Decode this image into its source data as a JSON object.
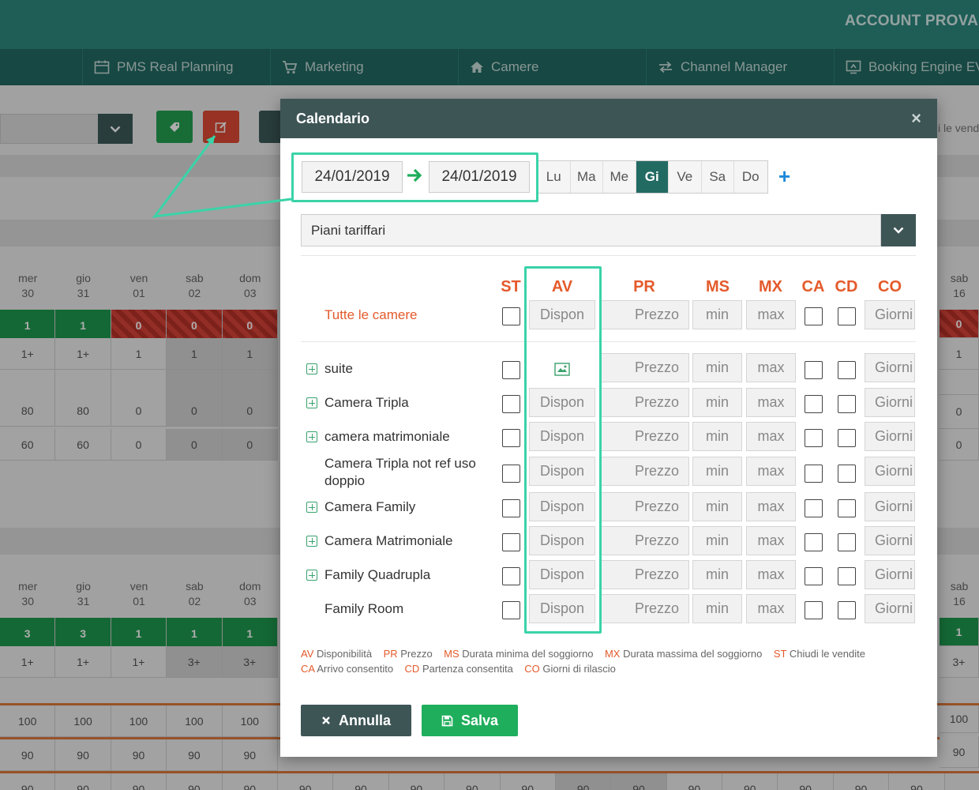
{
  "header": {
    "account": "ACCOUNT PROVA SU"
  },
  "nav": [
    {
      "label": "PMS Real Planning",
      "icon": "calendar-icon"
    },
    {
      "label": "Marketing",
      "icon": "cart-icon"
    },
    {
      "label": "Camere",
      "icon": "home-icon"
    },
    {
      "label": "Channel Manager",
      "icon": "arrows-icon"
    },
    {
      "label": "Booking Engine EVO",
      "icon": "screen-icon"
    }
  ],
  "background": {
    "side_text": "i le vendi",
    "days": [
      {
        "d": "mer",
        "n": "30"
      },
      {
        "d": "gio",
        "n": "31"
      },
      {
        "d": "ven",
        "n": "01"
      },
      {
        "d": "sab",
        "n": "02"
      },
      {
        "d": "dom",
        "n": "03"
      }
    ],
    "right_day": {
      "d": "sab",
      "n": "16"
    },
    "block1": {
      "avail": [
        "1",
        "1",
        "0",
        "0",
        "0"
      ],
      "right_avail": "0",
      "min": [
        "1+",
        "1+",
        "1",
        "1",
        "1"
      ],
      "right_min": "1",
      "row3": [
        "80",
        "80",
        "0",
        "0",
        "0"
      ],
      "right_row3": "0",
      "row4": [
        "60",
        "60",
        "0",
        "0",
        "0"
      ],
      "right_row4": "0"
    },
    "block2": {
      "avail": [
        "3",
        "3",
        "1",
        "1",
        "1"
      ],
      "right_avail": "1",
      "min": [
        "1+",
        "1+",
        "1+",
        "3+",
        "3+"
      ],
      "right_min": "3+",
      "row3": [
        "100",
        "100",
        "100",
        "100",
        "100"
      ],
      "right_row3": "100",
      "row4": [
        "90",
        "90",
        "90",
        "90",
        "90"
      ],
      "right_row4": "90",
      "row5": [
        "90",
        "90",
        "90",
        "90",
        "90",
        "90",
        "90",
        "90",
        "90",
        "90",
        "90",
        "90",
        "90",
        "90",
        "90",
        "90",
        "90",
        "90"
      ]
    }
  },
  "modal": {
    "title": "Calendario",
    "close": "×",
    "date_from": "24/01/2019",
    "date_to": "24/01/2019",
    "days": [
      "Lu",
      "Ma",
      "Me",
      "Gi",
      "Ve",
      "Sa",
      "Do"
    ],
    "active_day": "Gi",
    "plus": "+",
    "rate_plan": "Piani tariffari",
    "columns": {
      "st": "ST",
      "av": "AV",
      "pr": "PR",
      "ms": "MS",
      "mx": "MX",
      "ca": "CA",
      "cd": "CD",
      "co": "CO"
    },
    "placeholders": {
      "av": "Dispon",
      "pr": "Prezzo",
      "ms": "min",
      "mx": "max",
      "co": "Giorni"
    },
    "all_rooms": "Tutte le camere",
    "rooms": [
      {
        "name": "suite",
        "expandable": true
      },
      {
        "name": "Camera Tripla",
        "expandable": true
      },
      {
        "name": "camera matrimoniale",
        "expandable": true
      },
      {
        "name": "Camera Tripla not ref uso",
        "name2": "doppio",
        "expandable": false
      },
      {
        "name": "Camera Family",
        "expandable": true
      },
      {
        "name": "Camera Matrimoniale",
        "expandable": true
      },
      {
        "name": "Family Quadrupla",
        "expandable": true
      },
      {
        "name": "Family Room",
        "expandable": false
      }
    ],
    "legend": [
      {
        "code": "AV",
        "text": "Disponibilità"
      },
      {
        "code": "PR",
        "text": "Prezzo"
      },
      {
        "code": "MS",
        "text": "Durata minima del soggiorno"
      },
      {
        "code": "MX",
        "text": "Durata massima del soggiorno"
      },
      {
        "code": "ST",
        "text": "Chiudi le vendite"
      },
      {
        "code": "CA",
        "text": "Arrivo consentito"
      },
      {
        "code": "CD",
        "text": "Partenza consentita"
      },
      {
        "code": "CO",
        "text": "Giorni di rilascio"
      }
    ],
    "cancel": "Annulla",
    "save": "Salva"
  },
  "colors": {
    "accent": "#226b63",
    "orange": "#e45a2b",
    "save_green": "#1fae5c",
    "highlight": "#3ad3a8"
  }
}
